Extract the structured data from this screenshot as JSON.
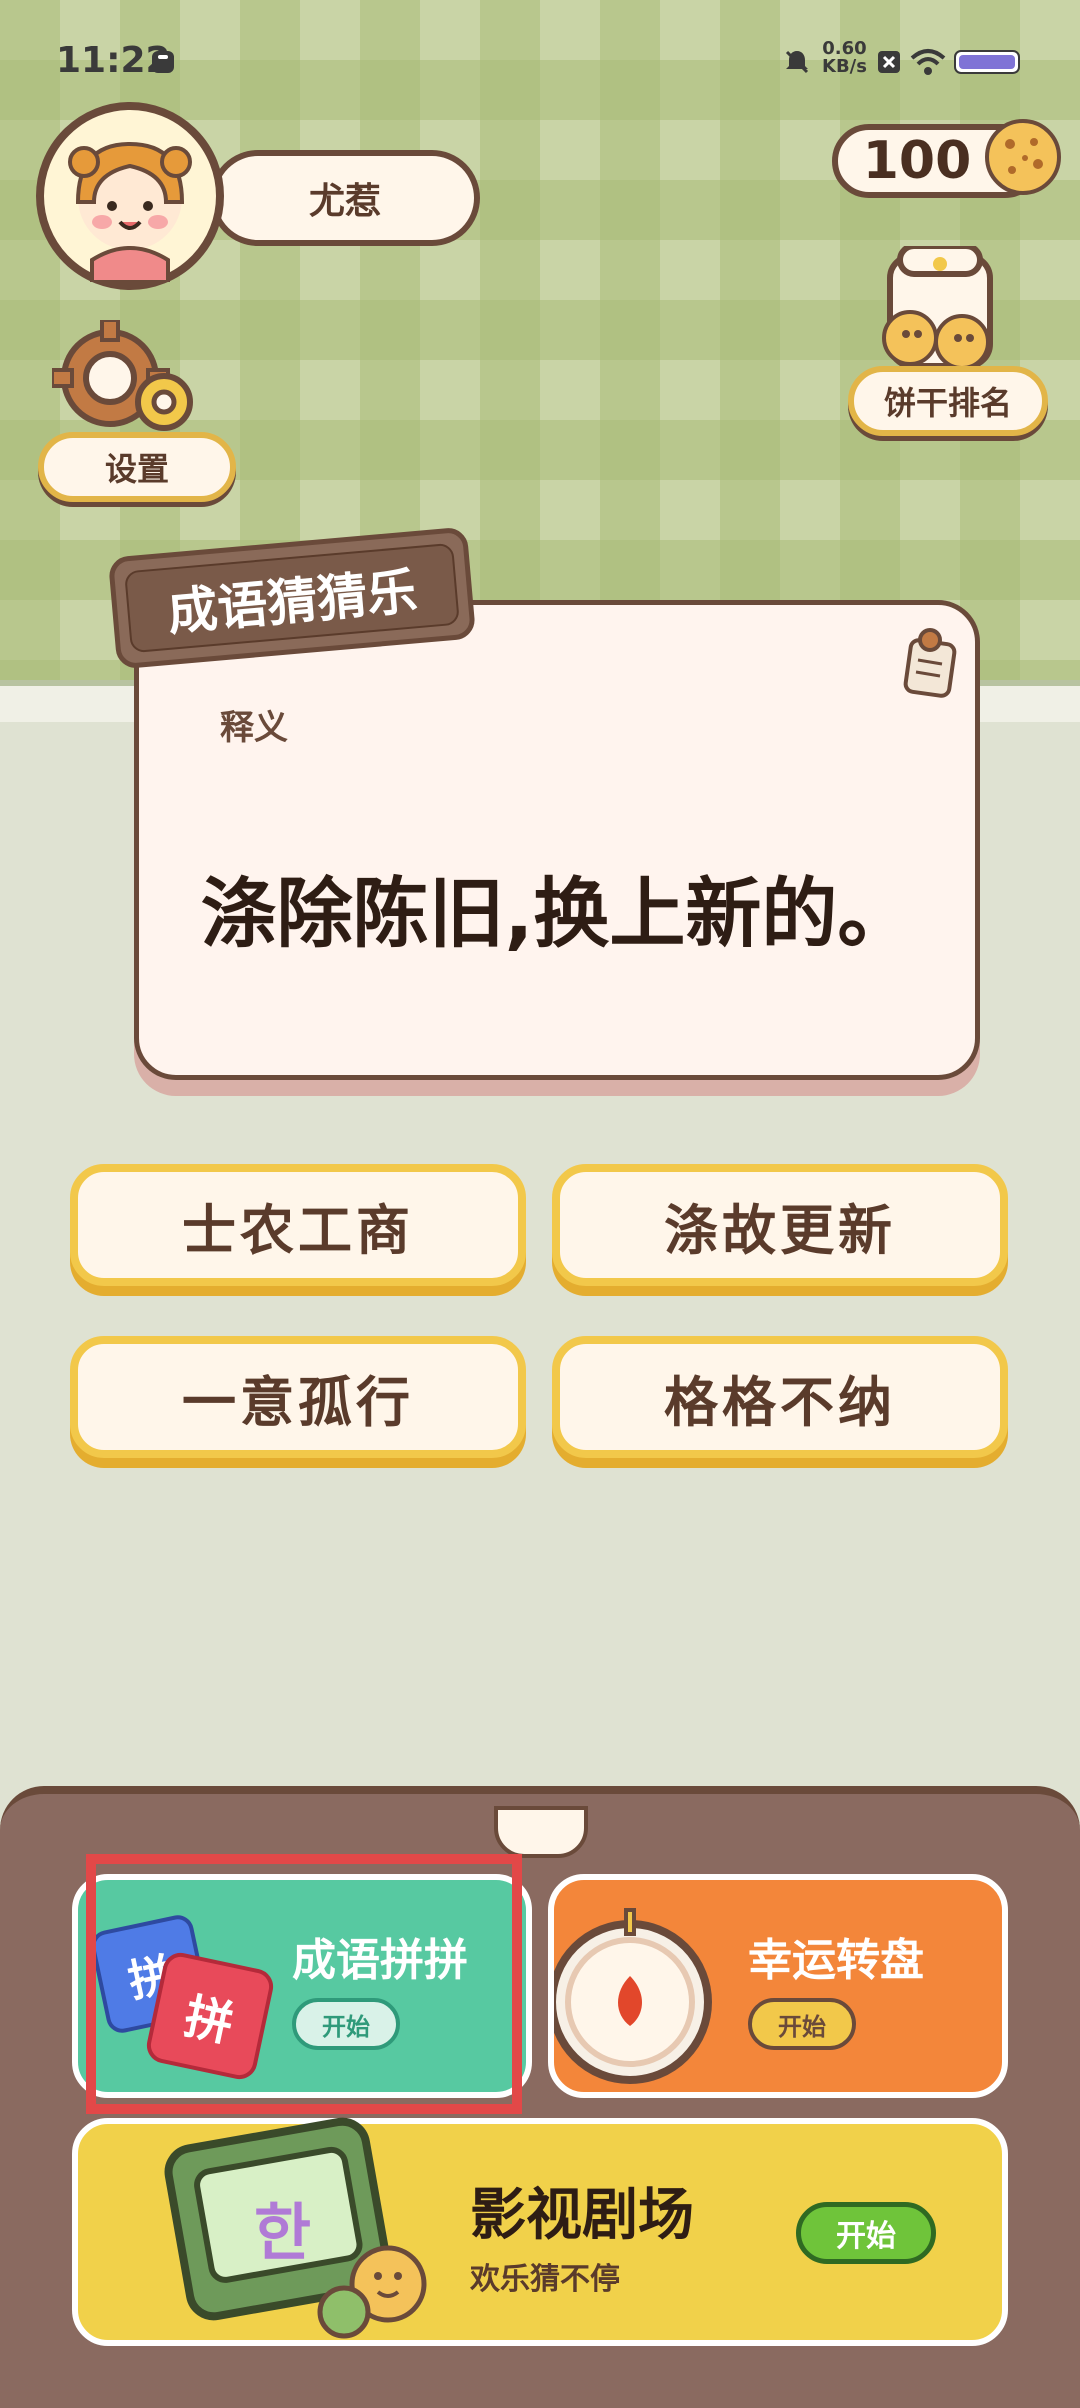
{
  "status_bar": {
    "time": "11:22",
    "speed_value": "0.60",
    "speed_unit": "KB/s"
  },
  "profile": {
    "name": "尤惹"
  },
  "coins": {
    "value": "100"
  },
  "settings": {
    "label": "设置"
  },
  "ranking": {
    "label": "饼干排名"
  },
  "card": {
    "title": "成语猜猜乐",
    "meaning_label": "释义",
    "question": "涤除陈旧,换上新的。"
  },
  "options": [
    "士农工商",
    "涤故更新",
    "一意孤行",
    "格格不纳"
  ],
  "games": {
    "pinyin": {
      "title": "成语拼拼",
      "start": "开始",
      "icon_chars": [
        "拼",
        "拼"
      ]
    },
    "wheel": {
      "title": "幸运转盘",
      "start": "开始"
    },
    "theater": {
      "title": "影视剧场",
      "subtitle": "欢乐猜不停",
      "start": "开始",
      "tv_char": "한"
    }
  },
  "colors": {
    "accent_brown": "#6a4a3a",
    "gold": "#f2c84a",
    "green_tile": "#57c9a1",
    "orange_tile": "#f3863a",
    "yellow_tile": "#f1d14a",
    "highlight": "#e24848"
  }
}
